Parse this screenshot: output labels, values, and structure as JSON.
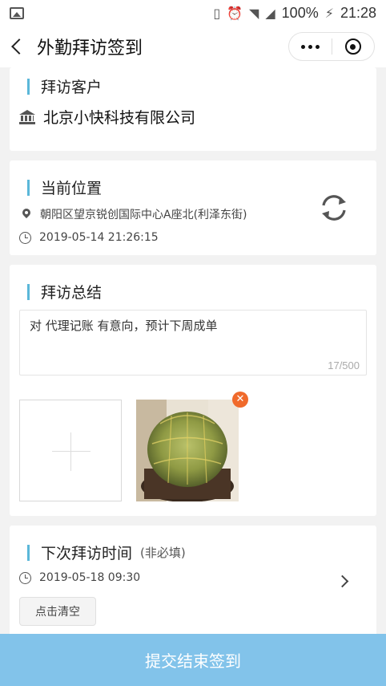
{
  "status_bar": {
    "battery_text": "100%",
    "time": "21:28",
    "icons": [
      "image-icon",
      "vibrate-icon",
      "alarm-icon",
      "wifi-icon",
      "signal-icon",
      "charging-icon"
    ]
  },
  "navbar": {
    "title": "外勤拜访签到"
  },
  "customer": {
    "section_title": "拜访客户",
    "company_name": "北京小快科技有限公司"
  },
  "location": {
    "section_title": "当前位置",
    "address": "朝阳区望京锐创国际中心A座北(利泽东街)",
    "timestamp": "2019-05-14 21:26:15"
  },
  "summary": {
    "section_title": "拜访总结",
    "text": "对 代理记账 有意向，预计下周成单",
    "counter": "17/500"
  },
  "next_visit": {
    "section_title": "下次拜访时间",
    "note": "(非必填)",
    "datetime": "2019-05-18 09:30",
    "clear_label": "点击清空"
  },
  "submit": {
    "label": "提交结束签到"
  },
  "colors": {
    "accent_bar": "#5bb7d9",
    "submit_bg": "#82c3ea",
    "delete_badge": "#f06a2b"
  }
}
